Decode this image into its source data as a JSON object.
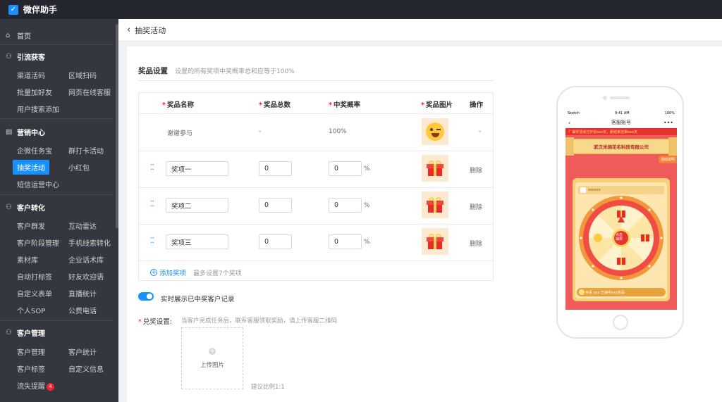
{
  "app": {
    "title": "微伴助手"
  },
  "sidebar": {
    "home": "首页",
    "sections": [
      {
        "title": "引流获客",
        "items": [
          "渠道活码",
          "区域扫码",
          "批量加好友",
          "网页在线客服",
          "用户搜索添加"
        ]
      },
      {
        "title": "营销中心",
        "items": [
          "企微任务宝",
          "群打卡活动",
          "抽奖活动",
          "小红包",
          "短信运营中心"
        ]
      },
      {
        "title": "客户转化",
        "items": [
          "客户群发",
          "互动雷达",
          "客户阶段管理",
          "手机线索转化",
          "素材库",
          "企业话术库",
          "自动打标签",
          "好友欢迎语",
          "自定义表单",
          "直播统计",
          "个人SOP",
          "公费电话"
        ]
      },
      {
        "title": "客户管理",
        "items": [
          "客户管理",
          "客户统计",
          "客户标签",
          "自定义信息",
          "流失提醒"
        ]
      }
    ],
    "active": "抽奖活动",
    "badge": "4"
  },
  "header": {
    "back_label": "抽奖活动"
  },
  "prize": {
    "title": "奖品设置",
    "hint": "设置的所有奖项中奖概率总和应等于100%",
    "columns": [
      "奖品名称",
      "奖品总数",
      "中奖概率",
      "奖品图片",
      "操作"
    ],
    "default_row": {
      "name": "谢谢参与",
      "total": "-",
      "prob": "100%",
      "action": "-"
    },
    "rows": [
      {
        "name": "奖项一",
        "total": "0",
        "prob": "0",
        "pct": "%",
        "action": "删除"
      },
      {
        "name": "奖项二",
        "total": "0",
        "prob": "0",
        "pct": "%",
        "action": "删除"
      },
      {
        "name": "奖项三",
        "total": "0",
        "prob": "0",
        "pct": "%",
        "action": "删除"
      }
    ],
    "add_label": "添加奖项",
    "add_hint": "最多设置7个奖项"
  },
  "realtime": {
    "label": "实时展示已中奖客户记录",
    "on": true
  },
  "redeem": {
    "label": "兑奖设置:",
    "hint": "当客户完成任务后，联系客服领取奖励，请上传客服二维码",
    "upload_label": "上传图片",
    "ratio": "建议比例1:1"
  },
  "preview": {
    "time": "9:41 AM",
    "carrier": "Sketch",
    "battery": "100%",
    "nav_title": "客服账号",
    "ticker": "抽奖活动已开始xxx天，距结束还剩xxx天",
    "banner": "武汉米阔花名科技有限公司",
    "rules": "活动说明",
    "user": "xxxxxx",
    "center": [
      "点击",
      "抽奖"
    ],
    "winner": "恭喜 xxx 已抽中xxx奖品"
  },
  "colors": {
    "accent": "#1890ff",
    "sidebar": "#34373f",
    "topbar": "#23262e",
    "danger": "#f5222d"
  }
}
